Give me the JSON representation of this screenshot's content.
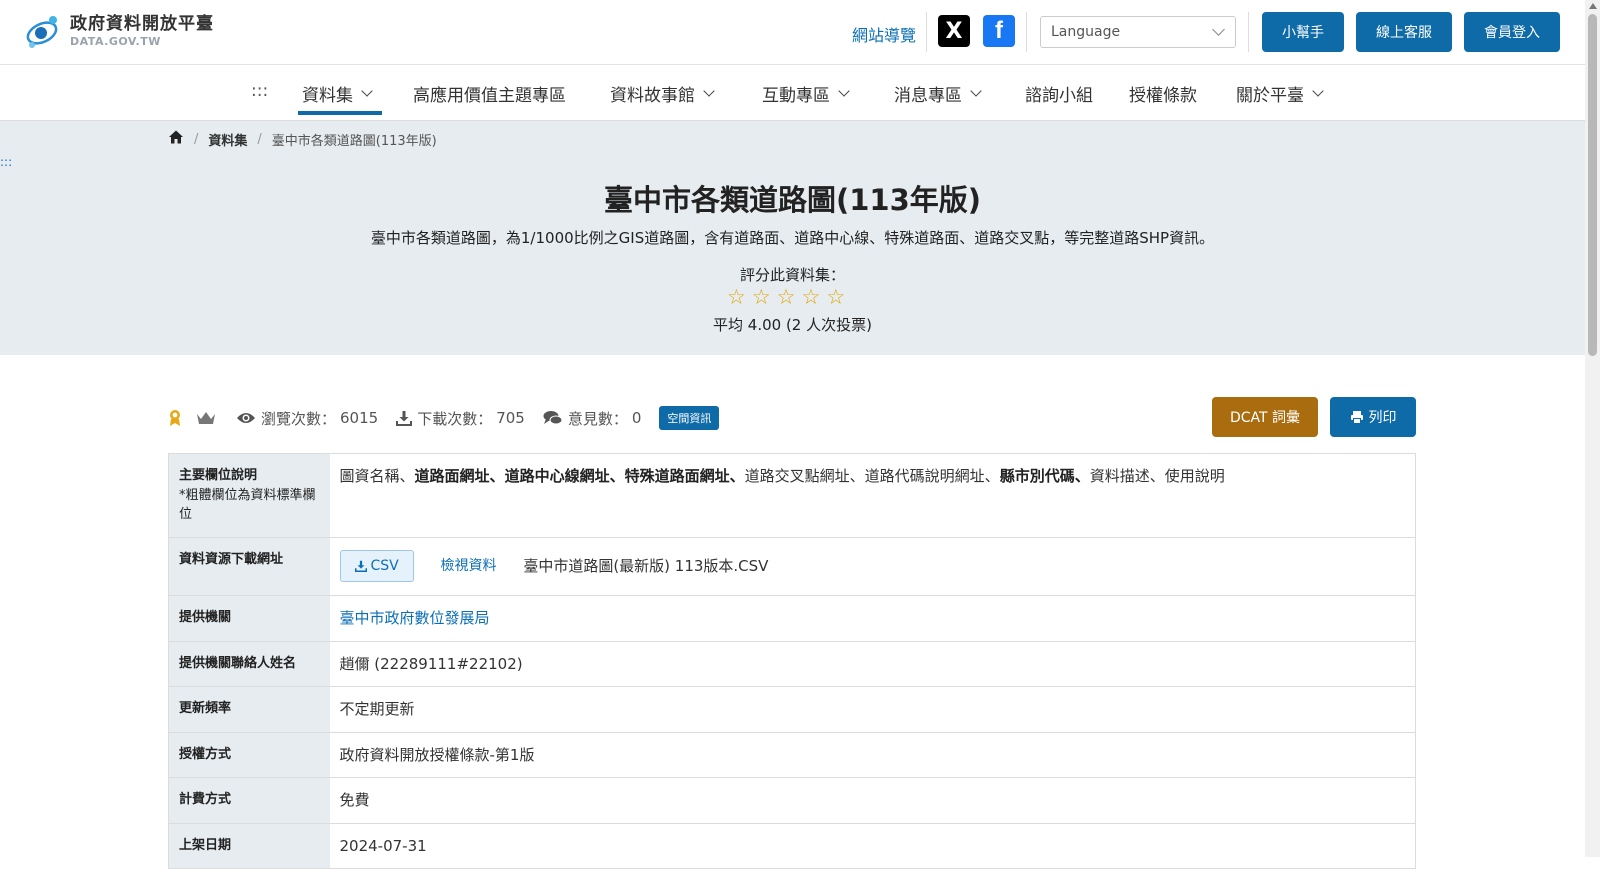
{
  "header": {
    "logo_title": "政府資料開放平臺",
    "logo_sub": "DATA.GOV.TW",
    "sitemap_label": "網站導覽",
    "social_x_label": "X",
    "social_fb_label": "f",
    "language_placeholder": "Language",
    "help_label": "小幫手",
    "service_label": "線上客服",
    "login_label": "會員登入"
  },
  "nav": {
    "accesskey": ":::",
    "items": [
      {
        "label": "資料集",
        "dropdown": true,
        "active": true
      },
      {
        "label": "高應用價值主題專區",
        "dropdown": false
      },
      {
        "label": "資料故事館",
        "dropdown": true
      },
      {
        "label": "互動專區",
        "dropdown": true
      },
      {
        "label": "消息專區",
        "dropdown": true
      },
      {
        "label": "諮詢小組",
        "dropdown": false
      },
      {
        "label": "授權條款",
        "dropdown": false
      },
      {
        "label": "關於平臺",
        "dropdown": true
      }
    ]
  },
  "breadcrumb": {
    "home_icon": "home-icon",
    "section": "資料集",
    "current": "臺中市各類道路圖(113年版)"
  },
  "hero": {
    "accesskey": ":::",
    "title": "臺中市各類道路圖(113年版)",
    "description": "臺中市各類道路圖，為1/1000比例之GIS道路圖，含有道路面、道路中心線、特殊道路面、道路交叉點，等完整道路SHP資訊。",
    "rate_label": "評分此資料集：",
    "stars_total": 5,
    "rating_average": "平均 4.00 (2 人次投票)"
  },
  "stats": {
    "views_label": "瀏覽次數：",
    "views_value": "6015",
    "downloads_label": "下載次數：",
    "downloads_value": "705",
    "comments_label": "意見數：",
    "comments_value": "0",
    "tag": "空間資訊",
    "dcat_label": "DCAT 詞彙",
    "print_label": "列印"
  },
  "details": {
    "fields_header": "主要欄位說明",
    "fields_note": "*粗體欄位為資料標準欄位",
    "fields": [
      {
        "text": "圖資名稱",
        "bold": false
      },
      {
        "text": "道路面網址",
        "bold": true
      },
      {
        "text": "道路中心線網址",
        "bold": true
      },
      {
        "text": "特殊道路面網址",
        "bold": true
      },
      {
        "text": "道路交叉點網址",
        "bold": false
      },
      {
        "text": "道路代碼說明網址",
        "bold": false
      },
      {
        "text": "縣市別代碼",
        "bold": true
      },
      {
        "text": "資料描述",
        "bold": false
      },
      {
        "text": "使用說明",
        "bold": false
      }
    ],
    "resource_header": "資料資源下載網址",
    "resource_format": "CSV",
    "resource_view": "檢視資料",
    "resource_name": "臺中市道路圖(最新版) 113版本.CSV",
    "org_header": "提供機關",
    "org_value": "臺中市政府數位發展局",
    "contact_header": "提供機關聯絡人姓名",
    "contact_value": "趙儞 (22289111#22102)",
    "freq_header": "更新頻率",
    "freq_value": "不定期更新",
    "license_header": "授權方式",
    "license_value": "政府資料開放授權條款-第1版",
    "fee_header": "計費方式",
    "fee_value": "免費",
    "date_header": "上架日期",
    "date_value": "2024-07-31"
  },
  "colors": {
    "primary": "#0e6ba8",
    "dcat": "#a96d10",
    "hero_bg": "#e7ecf0",
    "star": "#e0a800"
  }
}
